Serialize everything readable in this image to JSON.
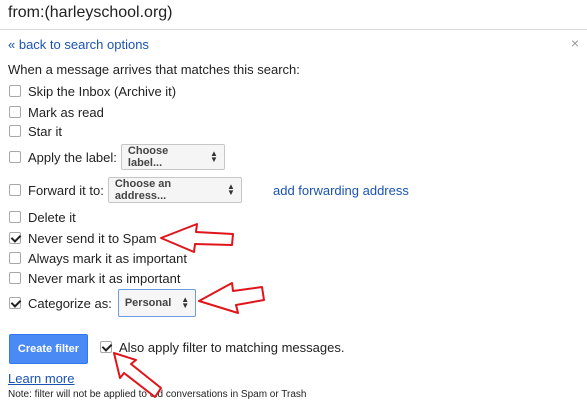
{
  "search": {
    "query": "from:(harleyschool.org)"
  },
  "header": {
    "back_label": "« back to search options",
    "close_glyph": "×"
  },
  "intro": "When a message arrives that matches this search:",
  "options": {
    "skip_inbox": {
      "label": "Skip the Inbox (Archive it)",
      "checked": false
    },
    "mark_read": {
      "label": "Mark as read",
      "checked": false
    },
    "star": {
      "label": "Star it",
      "checked": false
    },
    "apply_label": {
      "label": "Apply the label:",
      "checked": false,
      "select_value": "Choose label..."
    },
    "forward": {
      "label": "Forward it to:",
      "checked": false,
      "select_value": "Choose an address...",
      "link": "add forwarding address"
    },
    "delete": {
      "label": "Delete it",
      "checked": false
    },
    "never_spam": {
      "label": "Never send it to Spam",
      "checked": true
    },
    "always_important": {
      "label": "Always mark it as important",
      "checked": false
    },
    "never_important": {
      "label": "Never mark it as important",
      "checked": false
    },
    "categorize": {
      "label": "Categorize as:",
      "checked": true,
      "select_value": "Personal"
    }
  },
  "actions": {
    "create_label": "Create filter",
    "also_apply_label": "Also apply filter to matching messages.",
    "also_apply_checked": true,
    "learn_more": "Learn more",
    "note": "Note: filter will not be applied to old conversations in Spam or Trash"
  },
  "colors": {
    "accent": "#4a8af4",
    "link": "#1a53b5",
    "annotation_arrow": "#e0151b"
  },
  "icons": {
    "select_arrows": "updown-arrows-icon",
    "annotation": "red-arrow-icon"
  }
}
